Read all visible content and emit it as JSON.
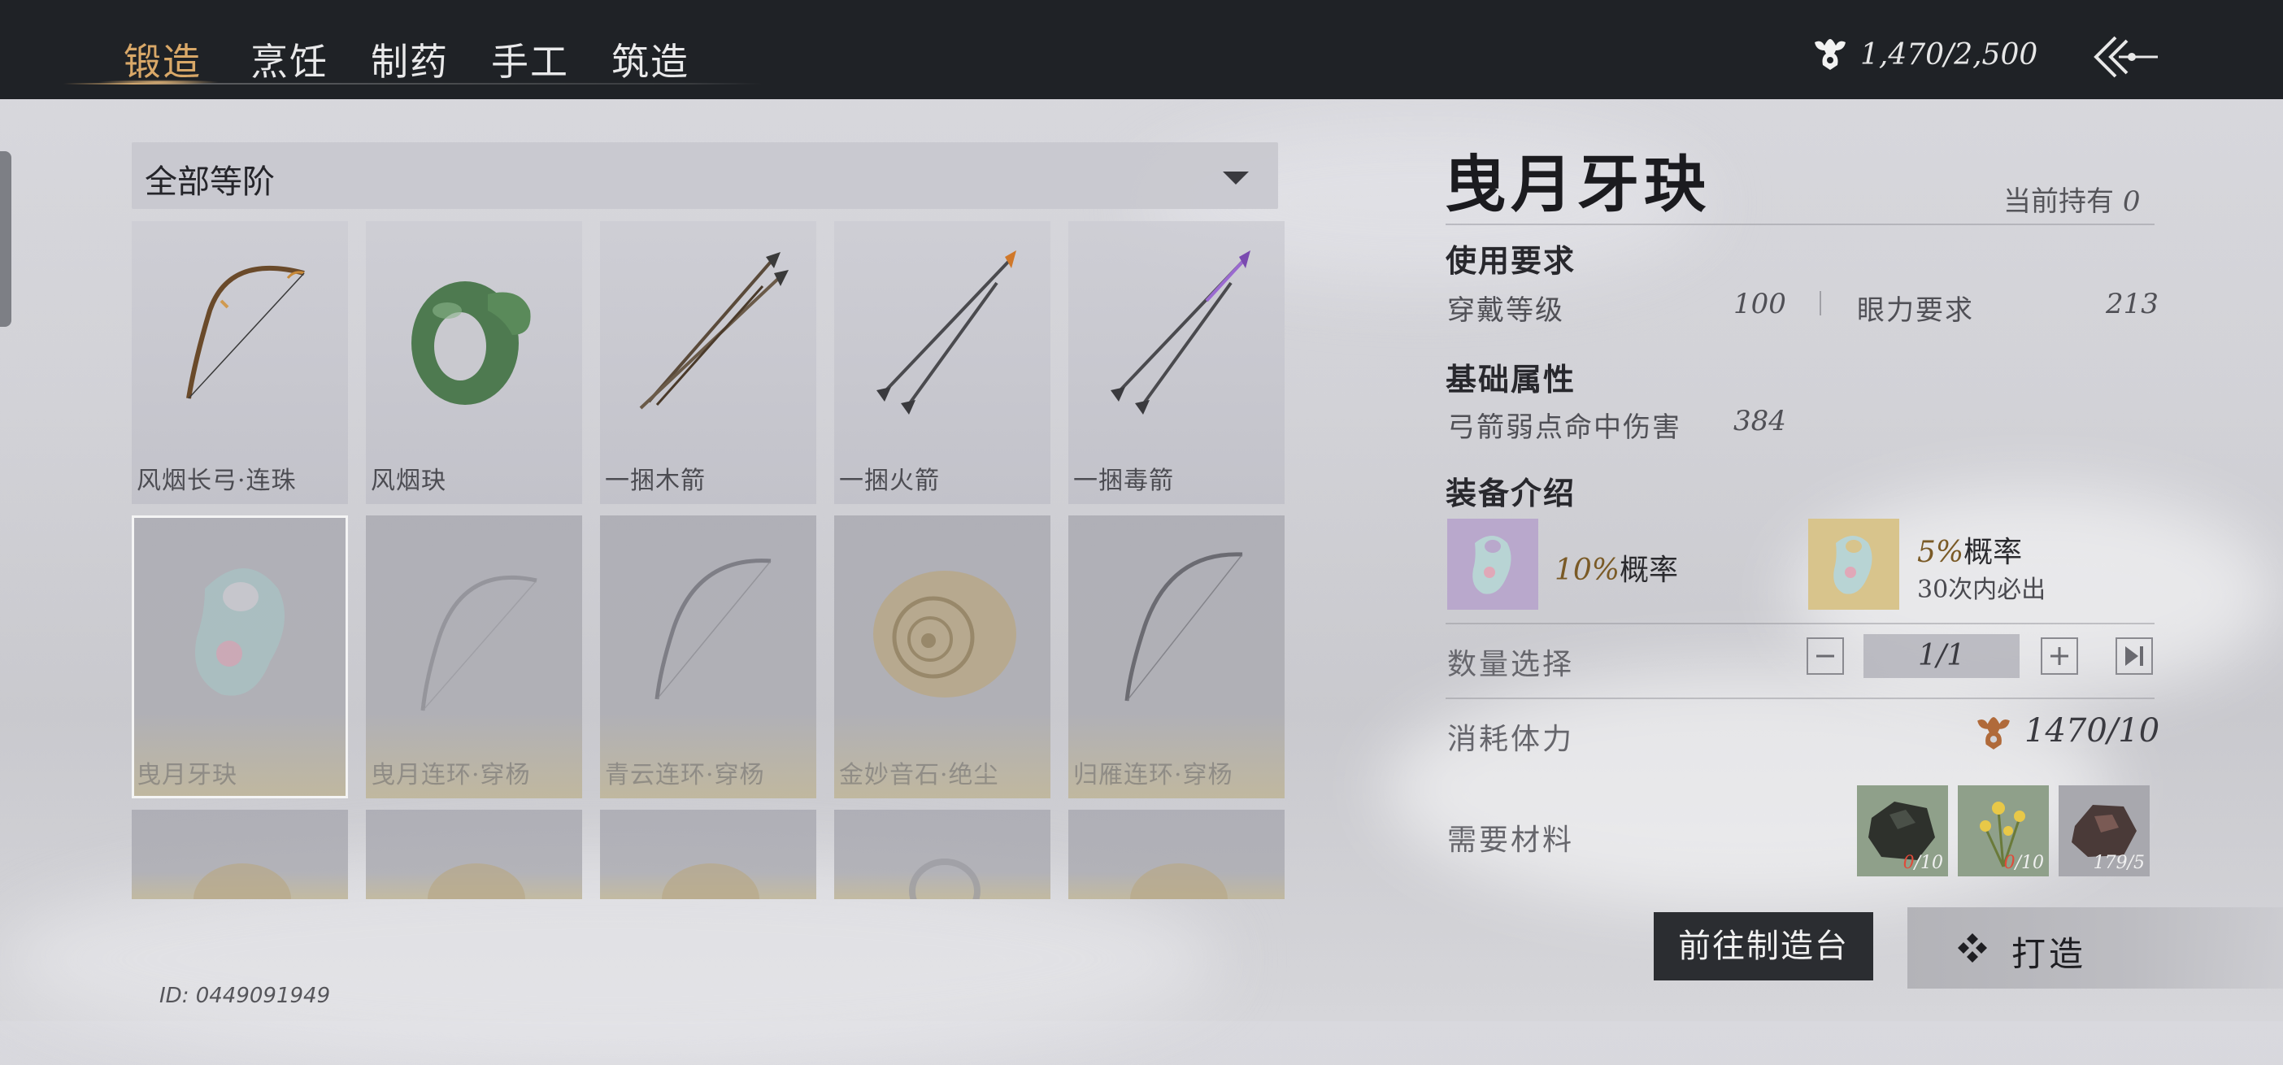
{
  "tabs": [
    {
      "label": "锻造",
      "active": true
    },
    {
      "label": "烹饪",
      "active": false
    },
    {
      "label": "制药",
      "active": false
    },
    {
      "label": "手工",
      "active": false
    },
    {
      "label": "筑造",
      "active": false
    }
  ],
  "stamina": {
    "text": "1,470/2,500",
    "icon": "stamina-icon"
  },
  "back_button": {
    "icon": "back-arrow-icon"
  },
  "filter": {
    "selected": "全部等阶"
  },
  "items": [
    {
      "label": "风烟长弓·连珠",
      "icon": "bow-icon"
    },
    {
      "label": "风烟玦",
      "icon": "jade-ring-icon"
    },
    {
      "label": "一捆木箭",
      "icon": "wood-arrows-icon"
    },
    {
      "label": "一捆火箭",
      "icon": "fire-arrows-icon"
    },
    {
      "label": "一捆毒箭",
      "icon": "poison-arrows-icon"
    },
    {
      "label": "曳月牙玦",
      "icon": "crescent-jade-icon",
      "selected": true
    },
    {
      "label": "曳月连环·穿杨",
      "icon": "bow-icon"
    },
    {
      "label": "青云连环·穿杨",
      "icon": "bow-icon"
    },
    {
      "label": "金妙音石·绝尘",
      "icon": "shell-stone-icon"
    },
    {
      "label": "归雁连环·穿杨",
      "icon": "bow-icon"
    }
  ],
  "detail": {
    "title": "曳月牙玦",
    "owned_label": "当前持有",
    "owned_count": "0",
    "requirements": {
      "title": "使用要求",
      "wear_level_label": "穿戴等级",
      "wear_level_value": "100",
      "sight_label": "眼力要求",
      "sight_value": "213"
    },
    "base_attr": {
      "title": "基础属性",
      "label": "弓箭弱点命中伤害",
      "value": "384"
    },
    "intro": {
      "title": "装备介绍",
      "left": {
        "pct": "10%",
        "text": "概率"
      },
      "right": {
        "pct": "5%",
        "text": "概率",
        "sub": "30次内必出"
      }
    },
    "quantity": {
      "label": "数量选择",
      "value": "1/1"
    },
    "cost": {
      "label": "消耗体力",
      "value": "1470/10"
    },
    "materials": {
      "label": "需要材料",
      "items": [
        {
          "have": "0",
          "need": "/10",
          "icon": "dark-ore-icon"
        },
        {
          "have": "0",
          "need": "/10",
          "icon": "yellow-herb-icon"
        },
        {
          "have": "179",
          "need": "/5",
          "icon": "iron-ore-icon"
        }
      ]
    }
  },
  "buttons": {
    "goto_bench": "前往制造台",
    "craft": "打造"
  },
  "player_id": "ID: 0449091949",
  "colors": {
    "active_tab": "#d9a868",
    "topbar": "#1f2226",
    "missing_material": "#e04a3a"
  }
}
